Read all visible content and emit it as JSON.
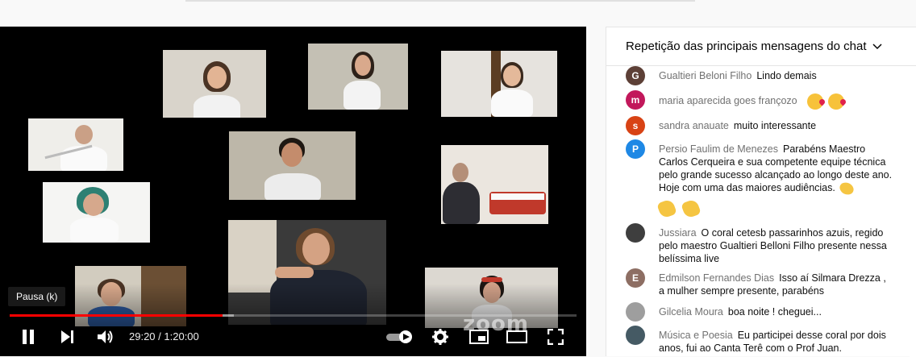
{
  "player": {
    "tooltip": "Pausa (k)",
    "time_current": "29:20",
    "time_separator": " / ",
    "time_total": "1:20:00",
    "progress_played": 0.375,
    "progress_loaded": 0.395,
    "watermark": "zoom"
  },
  "chat": {
    "header_title": "Repetição das principais mensagens do chat",
    "messages": [
      {
        "author": "Gualtieri Beloni Filho",
        "text": "Lindo demais",
        "avatar_letter": "G",
        "avatar_color": "#5d4037"
      },
      {
        "author": "maria aparecida goes françozo",
        "text": "",
        "avatar_letter": "m",
        "avatar_color": "#c2185b",
        "emoji": [
          "kiss",
          "kiss"
        ]
      },
      {
        "author": "sandra anauate",
        "text": "muito interessante",
        "avatar_letter": "s",
        "avatar_color": "#d84315"
      },
      {
        "author": "Persio Faulim de Menezes",
        "text": "Parabéns Maestro Carlos Cerqueira e sua competente equipe técnica pelo grande sucesso alcançado ao longo deste ano. Hoje com uma das maiores audiências.",
        "avatar_letter": "P",
        "avatar_color": "#1e88e5",
        "emoji": [
          "clap",
          "clap",
          "clap"
        ]
      },
      {
        "author": "Jussiara",
        "text": "O coral cetesb passarinhos azuis, regido pelo maestro Gualtieri Belloni Filho presente nessa belíssima live",
        "avatar_letter": "",
        "avatar_color": "#3e3e3e"
      },
      {
        "author": "Edmilson Fernandes Dias",
        "text": "Isso aí Silmara Drezza , a mulher sempre presente, parabéns",
        "avatar_letter": "E",
        "avatar_color": "#8d6e63"
      },
      {
        "author": "Gilcelia Moura",
        "text": "boa noite ! cheguei...",
        "avatar_letter": "",
        "avatar_color": "#9e9e9e"
      },
      {
        "author": "Música e Poesia",
        "text": "Eu participei desse coral por dois anos, fui ao Canta Terê com o Prof Juan.",
        "avatar_letter": "",
        "avatar_color": "#455a64"
      }
    ]
  },
  "colors": {
    "progress_red": "#ff0000",
    "chat_author": "#717171"
  }
}
